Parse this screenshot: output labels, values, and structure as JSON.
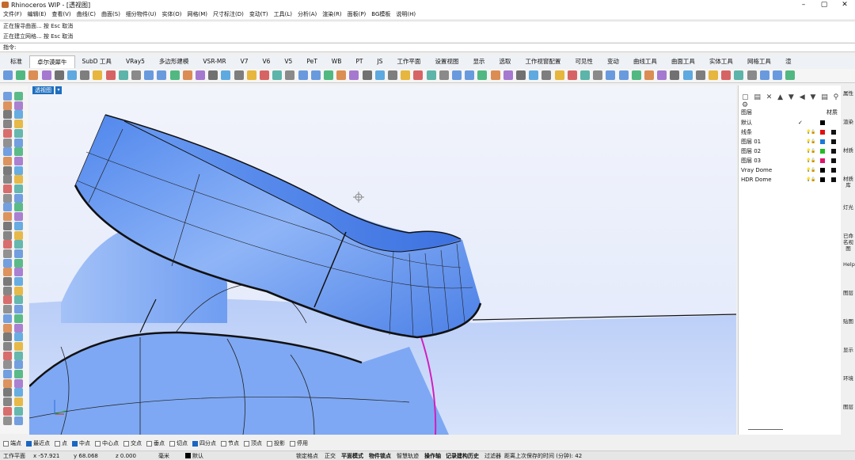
{
  "window": {
    "title": "Rhinoceros WIP - [透视图]",
    "min": "–",
    "max": "▢",
    "close": "✕"
  },
  "menu": [
    "文件(F)",
    "编辑(E)",
    "查看(V)",
    "曲线(C)",
    "曲面(S)",
    "细分物件(U)",
    "实体(O)",
    "网格(M)",
    "尺寸标注(D)",
    "变动(T)",
    "工具(L)",
    "分析(A)",
    "渲染(R)",
    "面板(P)",
    "BG模板",
    "说明(H)"
  ],
  "command": {
    "history": [
      "正在搜寻曲面... 按 Esc 取消",
      "正在建立网格... 按 Esc 取消"
    ],
    "prompt": "指令:"
  },
  "tabs": [
    "标准",
    "卓尔谟犀牛",
    "SubD 工具",
    "VRay5",
    "多边形建模",
    "VSR-MR",
    "V7",
    "V6",
    "V5",
    "PeT",
    "WB",
    "PT",
    "JS",
    "工作平面",
    "设置视图",
    "显示",
    "选取",
    "工作视窗配置",
    "可见性",
    "变动",
    "曲线工具",
    "曲面工具",
    "实体工具",
    "网格工具",
    "渲"
  ],
  "active_tab": "卓尔谟犀牛",
  "viewport": {
    "label": "透视图",
    "dropdown": "▾",
    "axes": {
      "x": "x",
      "y": "y",
      "z": "z"
    }
  },
  "panel": {
    "tools": "▢ ▤ ✕ ▲ ▼ ◀ ▼ ▤ ⚲ ⚙",
    "header_layer": "图层",
    "header_material": "材质",
    "layers": [
      {
        "name": "默认",
        "check": "✓",
        "color": "#000000"
      },
      {
        "name": "线条",
        "color": "#e01010"
      },
      {
        "name": "图层 01",
        "color": "#1a7ad8"
      },
      {
        "name": "图层 02",
        "color": "#22bb22"
      },
      {
        "name": "图层 03",
        "color": "#e0146e"
      },
      {
        "name": "Vray Dome",
        "color": "#000000"
      },
      {
        "name": "HDR Dome",
        "color": "#000000"
      }
    ]
  },
  "side_tabs": [
    "属性",
    "渲染",
    "材质",
    "材质库",
    "灯光",
    "已命名视图",
    "Help",
    "图层",
    "贴图",
    "显示",
    "环境",
    "图层"
  ],
  "osnap": [
    {
      "label": "端点",
      "on": false
    },
    {
      "label": "最近点",
      "on": true
    },
    {
      "label": "点",
      "on": false
    },
    {
      "label": "中点",
      "on": true
    },
    {
      "label": "中心点",
      "on": false
    },
    {
      "label": "交点",
      "on": false
    },
    {
      "label": "垂点",
      "on": false
    },
    {
      "label": "切点",
      "on": false
    },
    {
      "label": "四分点",
      "on": true
    },
    {
      "label": "节点",
      "on": false
    },
    {
      "label": "顶点",
      "on": false
    },
    {
      "label": "投影",
      "on": false
    },
    {
      "label": "停用",
      "on": false
    }
  ],
  "status": {
    "cplane": "工作平面",
    "x": "x -57.921",
    "y": "y 68.068",
    "z": "z 0.000",
    "unit": "毫米",
    "layer": "默认",
    "lock": "锁定格点",
    "ortho": "正交",
    "planar": "平面模式",
    "osnap": "物件锁点",
    "smarttrack": "智慧轨迹",
    "gumball": "操作轴",
    "history": "记录建构历史",
    "filter": "过滤器",
    "autosave": "距离上次保存的时间 (分钟): 42"
  },
  "colors": {
    "accent": "#1e6fbf",
    "surface": "#5b93f0",
    "magenta": "#d21fbd"
  }
}
